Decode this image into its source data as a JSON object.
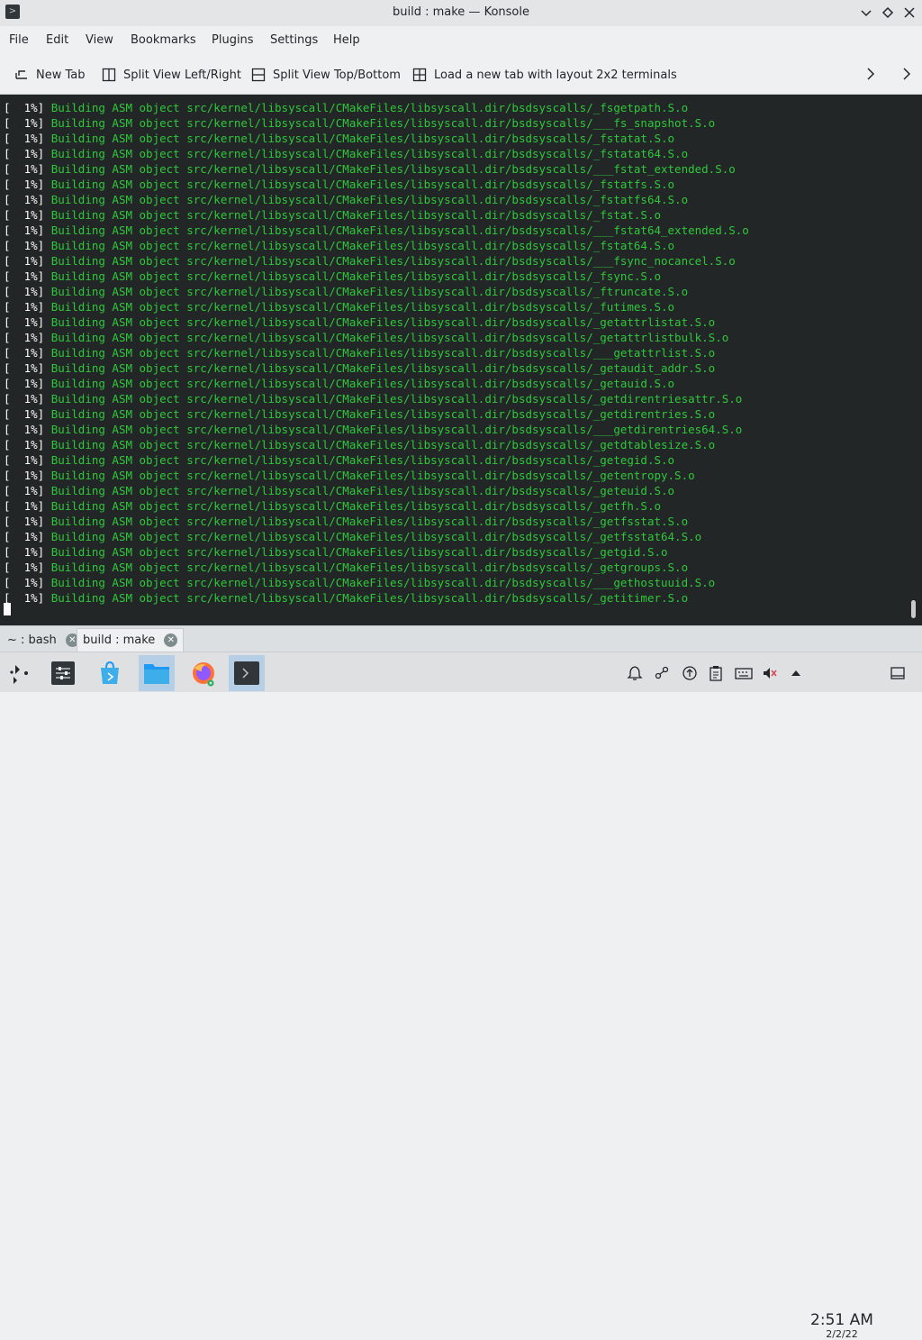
{
  "window": {
    "title": "build : make — Konsole"
  },
  "menu": [
    "File",
    "Edit",
    "View",
    "Bookmarks",
    "Plugins",
    "Settings",
    "Help"
  ],
  "toolbar": {
    "new_tab": "New Tab",
    "split_lr": "Split View Left/Right",
    "split_tb": "Split View Top/Bottom",
    "layout_2x2": "Load a new tab with layout 2x2 terminals"
  },
  "terminal": {
    "prefix": "[  1%]",
    "lines": [
      "Building ASM object src/kernel/libsyscall/CMakeFiles/libsyscall.dir/bsdsyscalls/_fsgetpath.S.o",
      "Building ASM object src/kernel/libsyscall/CMakeFiles/libsyscall.dir/bsdsyscalls/___fs_snapshot.S.o",
      "Building ASM object src/kernel/libsyscall/CMakeFiles/libsyscall.dir/bsdsyscalls/_fstatat.S.o",
      "Building ASM object src/kernel/libsyscall/CMakeFiles/libsyscall.dir/bsdsyscalls/_fstatat64.S.o",
      "Building ASM object src/kernel/libsyscall/CMakeFiles/libsyscall.dir/bsdsyscalls/___fstat_extended.S.o",
      "Building ASM object src/kernel/libsyscall/CMakeFiles/libsyscall.dir/bsdsyscalls/_fstatfs.S.o",
      "Building ASM object src/kernel/libsyscall/CMakeFiles/libsyscall.dir/bsdsyscalls/_fstatfs64.S.o",
      "Building ASM object src/kernel/libsyscall/CMakeFiles/libsyscall.dir/bsdsyscalls/_fstat.S.o",
      "Building ASM object src/kernel/libsyscall/CMakeFiles/libsyscall.dir/bsdsyscalls/___fstat64_extended.S.o",
      "Building ASM object src/kernel/libsyscall/CMakeFiles/libsyscall.dir/bsdsyscalls/_fstat64.S.o",
      "Building ASM object src/kernel/libsyscall/CMakeFiles/libsyscall.dir/bsdsyscalls/___fsync_nocancel.S.o",
      "Building ASM object src/kernel/libsyscall/CMakeFiles/libsyscall.dir/bsdsyscalls/_fsync.S.o",
      "Building ASM object src/kernel/libsyscall/CMakeFiles/libsyscall.dir/bsdsyscalls/_ftruncate.S.o",
      "Building ASM object src/kernel/libsyscall/CMakeFiles/libsyscall.dir/bsdsyscalls/_futimes.S.o",
      "Building ASM object src/kernel/libsyscall/CMakeFiles/libsyscall.dir/bsdsyscalls/_getattrlistat.S.o",
      "Building ASM object src/kernel/libsyscall/CMakeFiles/libsyscall.dir/bsdsyscalls/_getattrlistbulk.S.o",
      "Building ASM object src/kernel/libsyscall/CMakeFiles/libsyscall.dir/bsdsyscalls/___getattrlist.S.o",
      "Building ASM object src/kernel/libsyscall/CMakeFiles/libsyscall.dir/bsdsyscalls/_getaudit_addr.S.o",
      "Building ASM object src/kernel/libsyscall/CMakeFiles/libsyscall.dir/bsdsyscalls/_getauid.S.o",
      "Building ASM object src/kernel/libsyscall/CMakeFiles/libsyscall.dir/bsdsyscalls/_getdirentriesattr.S.o",
      "Building ASM object src/kernel/libsyscall/CMakeFiles/libsyscall.dir/bsdsyscalls/_getdirentries.S.o",
      "Building ASM object src/kernel/libsyscall/CMakeFiles/libsyscall.dir/bsdsyscalls/___getdirentries64.S.o",
      "Building ASM object src/kernel/libsyscall/CMakeFiles/libsyscall.dir/bsdsyscalls/_getdtablesize.S.o",
      "Building ASM object src/kernel/libsyscall/CMakeFiles/libsyscall.dir/bsdsyscalls/_getegid.S.o",
      "Building ASM object src/kernel/libsyscall/CMakeFiles/libsyscall.dir/bsdsyscalls/_getentropy.S.o",
      "Building ASM object src/kernel/libsyscall/CMakeFiles/libsyscall.dir/bsdsyscalls/_geteuid.S.o",
      "Building ASM object src/kernel/libsyscall/CMakeFiles/libsyscall.dir/bsdsyscalls/_getfh.S.o",
      "Building ASM object src/kernel/libsyscall/CMakeFiles/libsyscall.dir/bsdsyscalls/_getfsstat.S.o",
      "Building ASM object src/kernel/libsyscall/CMakeFiles/libsyscall.dir/bsdsyscalls/_getfsstat64.S.o",
      "Building ASM object src/kernel/libsyscall/CMakeFiles/libsyscall.dir/bsdsyscalls/_getgid.S.o",
      "Building ASM object src/kernel/libsyscall/CMakeFiles/libsyscall.dir/bsdsyscalls/_getgroups.S.o",
      "Building ASM object src/kernel/libsyscall/CMakeFiles/libsyscall.dir/bsdsyscalls/___gethostuuid.S.o",
      "Building ASM object src/kernel/libsyscall/CMakeFiles/libsyscall.dir/bsdsyscalls/_getitimer.S.o"
    ]
  },
  "tabs": [
    {
      "label": "~ : bash",
      "active": false
    },
    {
      "label": "build : make",
      "active": true
    }
  ],
  "taskbar": {
    "apps": [
      "application-launcher-icon",
      "settings-icon",
      "discover-icon",
      "dolphin-icon",
      "firefox-icon",
      "konsole-icon"
    ],
    "clock_time": "2:51 AM",
    "clock_date": "2/2/22"
  },
  "colors": {
    "terminal_bg": "#232627",
    "terminal_text": "#2fc73a",
    "window_bg": "#eff0f1",
    "active_task": "#b6cfe6"
  }
}
